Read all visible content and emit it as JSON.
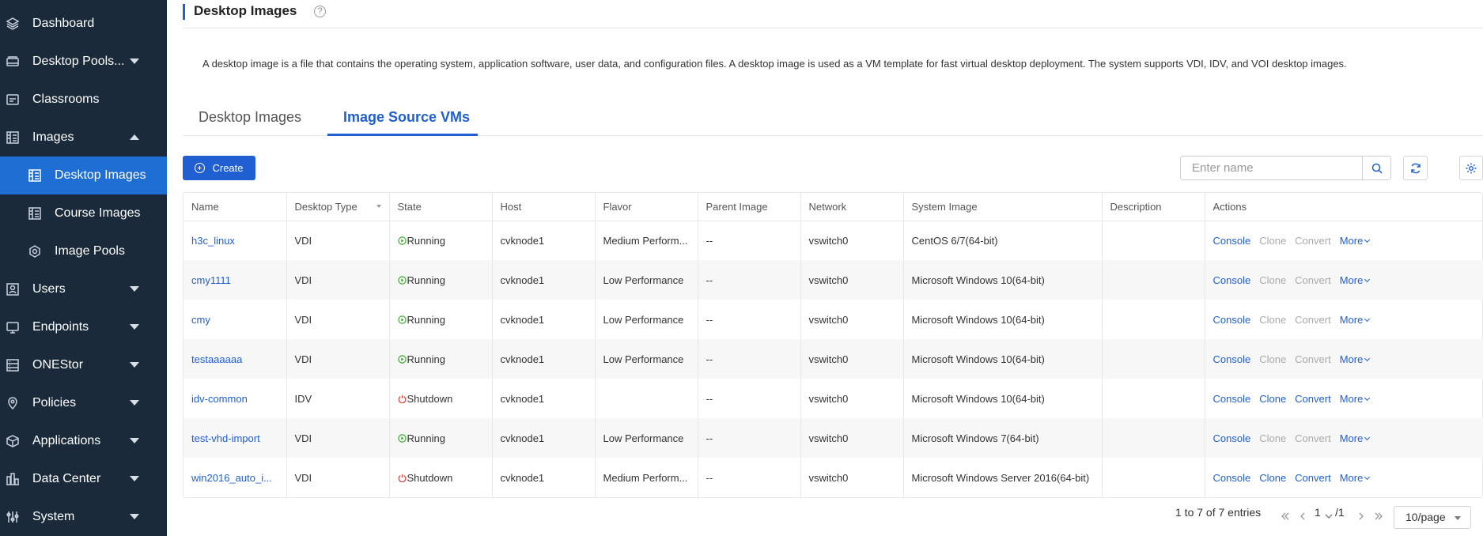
{
  "sidebar": {
    "items": [
      {
        "label": "Dashboard",
        "icon": "dashboard-icon"
      },
      {
        "label": "Desktop Pools...",
        "icon": "desktop-pools-icon"
      },
      {
        "label": "Classrooms",
        "icon": "classrooms-icon"
      },
      {
        "label": "Images",
        "icon": "images-icon"
      },
      {
        "label": "Desktop Images",
        "icon": "desktop-images-icon"
      },
      {
        "label": "Course Images",
        "icon": "course-images-icon"
      },
      {
        "label": "Image Pools",
        "icon": "image-pools-icon"
      },
      {
        "label": "Users",
        "icon": "users-icon"
      },
      {
        "label": "Endpoints",
        "icon": "endpoints-icon"
      },
      {
        "label": "ONEStor",
        "icon": "onestor-icon"
      },
      {
        "label": "Policies",
        "icon": "policies-icon"
      },
      {
        "label": "Applications",
        "icon": "applications-icon"
      },
      {
        "label": "Data Center",
        "icon": "data-center-icon"
      },
      {
        "label": "System",
        "icon": "system-icon"
      }
    ]
  },
  "header": {
    "title": "Desktop Images",
    "help_icon": "?"
  },
  "description": "A desktop image is a file that contains the operating system, application software, user data, and configuration files. A desktop image is used as a VM template for fast virtual desktop deployment. The system supports VDI, IDV, and VOI desktop images.",
  "tabs": [
    {
      "label": "Desktop Images"
    },
    {
      "label": "Image Source VMs"
    }
  ],
  "toolbar": {
    "create_label": "Create",
    "search_placeholder": "Enter name"
  },
  "table": {
    "columns": [
      "Name",
      "Desktop Type",
      "State",
      "Host",
      "Flavor",
      "Parent Image",
      "Network",
      "System Image",
      "Description",
      "Actions"
    ],
    "actions": [
      "Console",
      "Clone",
      "Convert",
      "More"
    ],
    "rows": [
      {
        "name": "h3c_linux",
        "type": "VDI",
        "state": "Running",
        "host": "cvknode1",
        "flavor": "Medium Perform...",
        "parent": "--",
        "network": "vswitch0",
        "system_image": "CentOS 6/7(64-bit)",
        "description": ""
      },
      {
        "name": "cmy1111",
        "type": "VDI",
        "state": "Running",
        "host": "cvknode1",
        "flavor": "Low Performance",
        "parent": "--",
        "network": "vswitch0",
        "system_image": "Microsoft Windows 10(64-bit)",
        "description": ""
      },
      {
        "name": "cmy",
        "type": "VDI",
        "state": "Running",
        "host": "cvknode1",
        "flavor": "Low Performance",
        "parent": "--",
        "network": "vswitch0",
        "system_image": "Microsoft Windows 10(64-bit)",
        "description": ""
      },
      {
        "name": "testaaaaaa",
        "type": "VDI",
        "state": "Running",
        "host": "cvknode1",
        "flavor": "Low Performance",
        "parent": "--",
        "network": "vswitch0",
        "system_image": "Microsoft Windows 10(64-bit)",
        "description": ""
      },
      {
        "name": "idv-common",
        "type": "IDV",
        "state": "Shutdown",
        "host": "cvknode1",
        "flavor": "",
        "parent": "--",
        "network": "vswitch0",
        "system_image": "Microsoft Windows 10(64-bit)",
        "description": ""
      },
      {
        "name": "test-vhd-import",
        "type": "VDI",
        "state": "Running",
        "host": "cvknode1",
        "flavor": "Low Performance",
        "parent": "--",
        "network": "vswitch0",
        "system_image": "Microsoft Windows 7(64-bit)",
        "description": ""
      },
      {
        "name": "win2016_auto_i...",
        "type": "VDI",
        "state": "Shutdown",
        "host": "cvknode1",
        "flavor": "Medium Perform...",
        "parent": "--",
        "network": "vswitch0",
        "system_image": "Microsoft Windows Server 2016(64-bit)",
        "description": ""
      }
    ]
  },
  "pagination": {
    "summary": "1 to 7 of 7 entries",
    "current_page": "1",
    "total_pages": "/1",
    "page_size": "10/page"
  },
  "colors": {
    "sidebar_bg": "#1b2a3b",
    "accent": "#1f5fd1",
    "running": "#3aa82c",
    "shutdown": "#e0403a"
  }
}
